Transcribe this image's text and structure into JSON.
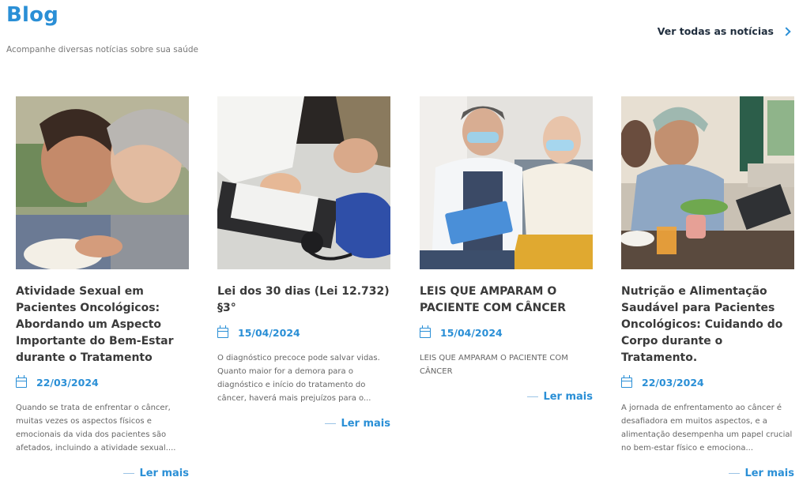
{
  "header": {
    "title": "Blog",
    "subtitle": "Acompanhe diversas notícias sobre sua saúde",
    "see_all_label": "Ver todas as notícias"
  },
  "posts": [
    {
      "title": "Atividade Sexual em Pacientes Oncológicos: Abordando um Aspecto Importante do Bem-Estar durante o Tratamento",
      "date": "22/03/2024",
      "excerpt": "Quando se trata de enfrentar o câncer, muitas vezes os aspectos físicos e emocionais da vida dos pacientes são afetados, incluindo a atividade sexual....",
      "read_more": "Ler mais"
    },
    {
      "title": "Lei dos 30 dias (Lei 12.732) §3°",
      "date": "15/04/2024",
      "excerpt": "O diagnóstico precoce pode salvar vidas. Quanto maior for a demora para o diagnóstico e início do tratamento do câncer, haverá mais prejuízos para o...",
      "read_more": "Ler mais"
    },
    {
      "title": "LEIS QUE AMPARAM O PACIENTE COM CÂNCER",
      "date": "15/04/2024",
      "excerpt": "LEIS QUE AMPARAM O PACIENTE COM CÂNCER",
      "read_more": "Ler mais"
    },
    {
      "title": "Nutrição e Alimentação Saudável para Pacientes Oncológicos: Cuidando do Corpo durante o Tratamento.",
      "date": "22/03/2024",
      "excerpt": "A jornada de enfrentamento ao câncer é desafiadora em muitos aspectos, e a alimentação desempenha um papel crucial no bem-estar físico e emociona...",
      "read_more": "Ler mais"
    }
  ],
  "icons": {
    "see_all": "chevron-right-icon",
    "date": "calendar-icon"
  },
  "colors": {
    "accent": "#2a8fd6",
    "heading": "#1f2d3d",
    "body_text": "#666666"
  }
}
